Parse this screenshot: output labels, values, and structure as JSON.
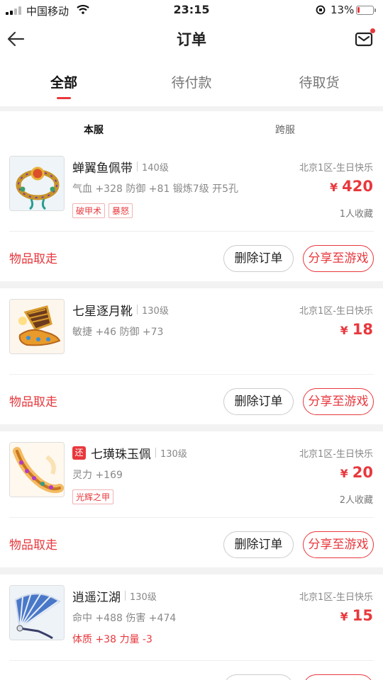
{
  "status_bar": {
    "carrier": "中国移动",
    "time": "23:15",
    "battery": "13%",
    "battery_level": 0.13
  },
  "header": {
    "title": "订单"
  },
  "tabs": [
    {
      "label": "全部",
      "active": true
    },
    {
      "label": "待付款",
      "active": false
    },
    {
      "label": "待取货",
      "active": false
    }
  ],
  "subtabs": [
    {
      "label": "本服",
      "active": true
    },
    {
      "label": "跨服",
      "active": false
    }
  ],
  "orders": [
    {
      "name": "蝉翼鱼佩带",
      "returned_badge": "",
      "level": "140级",
      "server": "北京1区-生日快乐",
      "attributes": "气血 +328 防御 +81 锻炼7级 开5孔",
      "attributes_red": "",
      "currency": "¥",
      "price": "420",
      "tags": [
        "破甲术",
        "暴怒"
      ],
      "favorites": "1人收藏",
      "status": "物品取走",
      "delete_label": "删除订单",
      "share_label": "分享至游戏",
      "image_icon": "ring-icon"
    },
    {
      "name": "七星逐月靴",
      "returned_badge": "",
      "level": "130级",
      "server": "北京1区-生日快乐",
      "attributes": "敏捷 +46 防御 +73",
      "attributes_red": "",
      "currency": "¥",
      "price": "18",
      "tags": [],
      "favorites": "",
      "status": "物品取走",
      "delete_label": "删除订单",
      "share_label": "分享至游戏",
      "image_icon": "boots-icon"
    },
    {
      "name": "七璜珠玉佩",
      "returned_badge": "还",
      "level": "130级",
      "server": "北京1区-生日快乐",
      "attributes": "灵力 +169",
      "attributes_red": "",
      "currency": "¥",
      "price": "20",
      "tags": [
        "光辉之甲"
      ],
      "favorites": "2人收藏",
      "status": "物品取走",
      "delete_label": "删除订单",
      "share_label": "分享至游戏",
      "image_icon": "jade-pendant-icon"
    },
    {
      "name": "逍遥江湖",
      "returned_badge": "",
      "level": "130级",
      "server": "北京1区-生日快乐",
      "attributes": "命中 +488 伤害 +474",
      "attributes_red": "体质 +38 力量 -3",
      "currency": "¥",
      "price": "15",
      "tags": [],
      "favorites": "",
      "status": "",
      "delete_label": "",
      "share_label": "",
      "image_icon": "fan-icon"
    }
  ],
  "colors": {
    "accent": "#e8383d",
    "muted": "#888888",
    "background": "#f2f2f2"
  }
}
